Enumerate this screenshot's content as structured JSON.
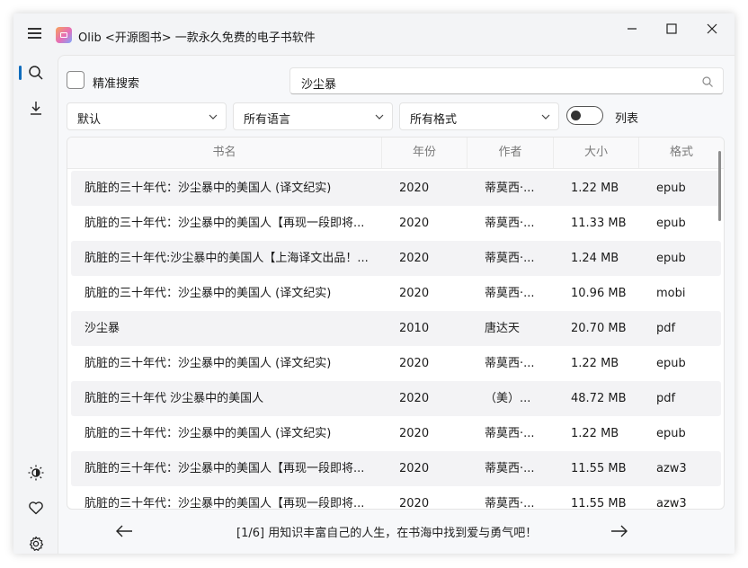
{
  "window": {
    "app_title": "Olib <开源图书> 一款永久免费的电子书软件",
    "controls": [
      "minimize",
      "maximize",
      "close"
    ]
  },
  "sidebar": {
    "top_icons": [
      "search-icon",
      "download-icon"
    ],
    "bottom_icons": [
      "theme-icon",
      "heart-icon",
      "settings-icon"
    ],
    "active": "search"
  },
  "search": {
    "exact_label": "精准搜索",
    "exact_checked": false,
    "query": "沙尘暴"
  },
  "filters": {
    "sort": "默认",
    "language": "所有语言",
    "format": "所有格式",
    "list_label": "列表",
    "list_on": false
  },
  "table": {
    "headers": [
      "书名",
      "年份",
      "作者",
      "大小",
      "格式"
    ],
    "rows": [
      [
        "肮脏的三十年代：沙尘暴中的美国人 (译文纪实)",
        "2020",
        "蒂莫西·...",
        "1.22 MB",
        "epub"
      ],
      [
        "肮脏的三十年代：沙尘暴中的美国人【再现一段即将...",
        "2020",
        "蒂莫西·...",
        "11.33 MB",
        "epub"
      ],
      [
        "肮脏的三十年代:沙尘暴中的美国人【上海译文出品！...",
        "2020",
        "蒂莫西·...",
        "1.24 MB",
        "epub"
      ],
      [
        "肮脏的三十年代：沙尘暴中的美国人 (译文纪实)",
        "2020",
        "蒂莫西·...",
        "10.96 MB",
        "mobi"
      ],
      [
        "沙尘暴",
        "2010",
        "唐达天",
        "20.70 MB",
        "pdf"
      ],
      [
        "肮脏的三十年代：沙尘暴中的美国人 (译文纪实)",
        "2020",
        "蒂莫西·...",
        "1.22 MB",
        "epub"
      ],
      [
        "肮脏的三十年代 沙尘暴中的美国人",
        "2020",
        "（美）...",
        "48.72 MB",
        "pdf"
      ],
      [
        "肮脏的三十年代：沙尘暴中的美国人 (译文纪实)",
        "2020",
        "蒂莫西·...",
        "1.22 MB",
        "epub"
      ],
      [
        "肮脏的三十年代：沙尘暴中的美国人【再现一段即将...",
        "2020",
        "蒂莫西·...",
        "11.55 MB",
        "azw3"
      ],
      [
        "肮脏的三十年代：沙尘暴中的美国人【再现一段即将...",
        "2020",
        "蒂莫西·...",
        "11.55 MB",
        "azw3"
      ]
    ]
  },
  "footer": {
    "status": "[1/6] 用知识丰富自己的人生，在书海中找到爱与勇气吧！"
  },
  "colors": {
    "accent": "#0f6cbd",
    "background": "#f3f4f6",
    "row_alt": "#f3f3f5"
  }
}
